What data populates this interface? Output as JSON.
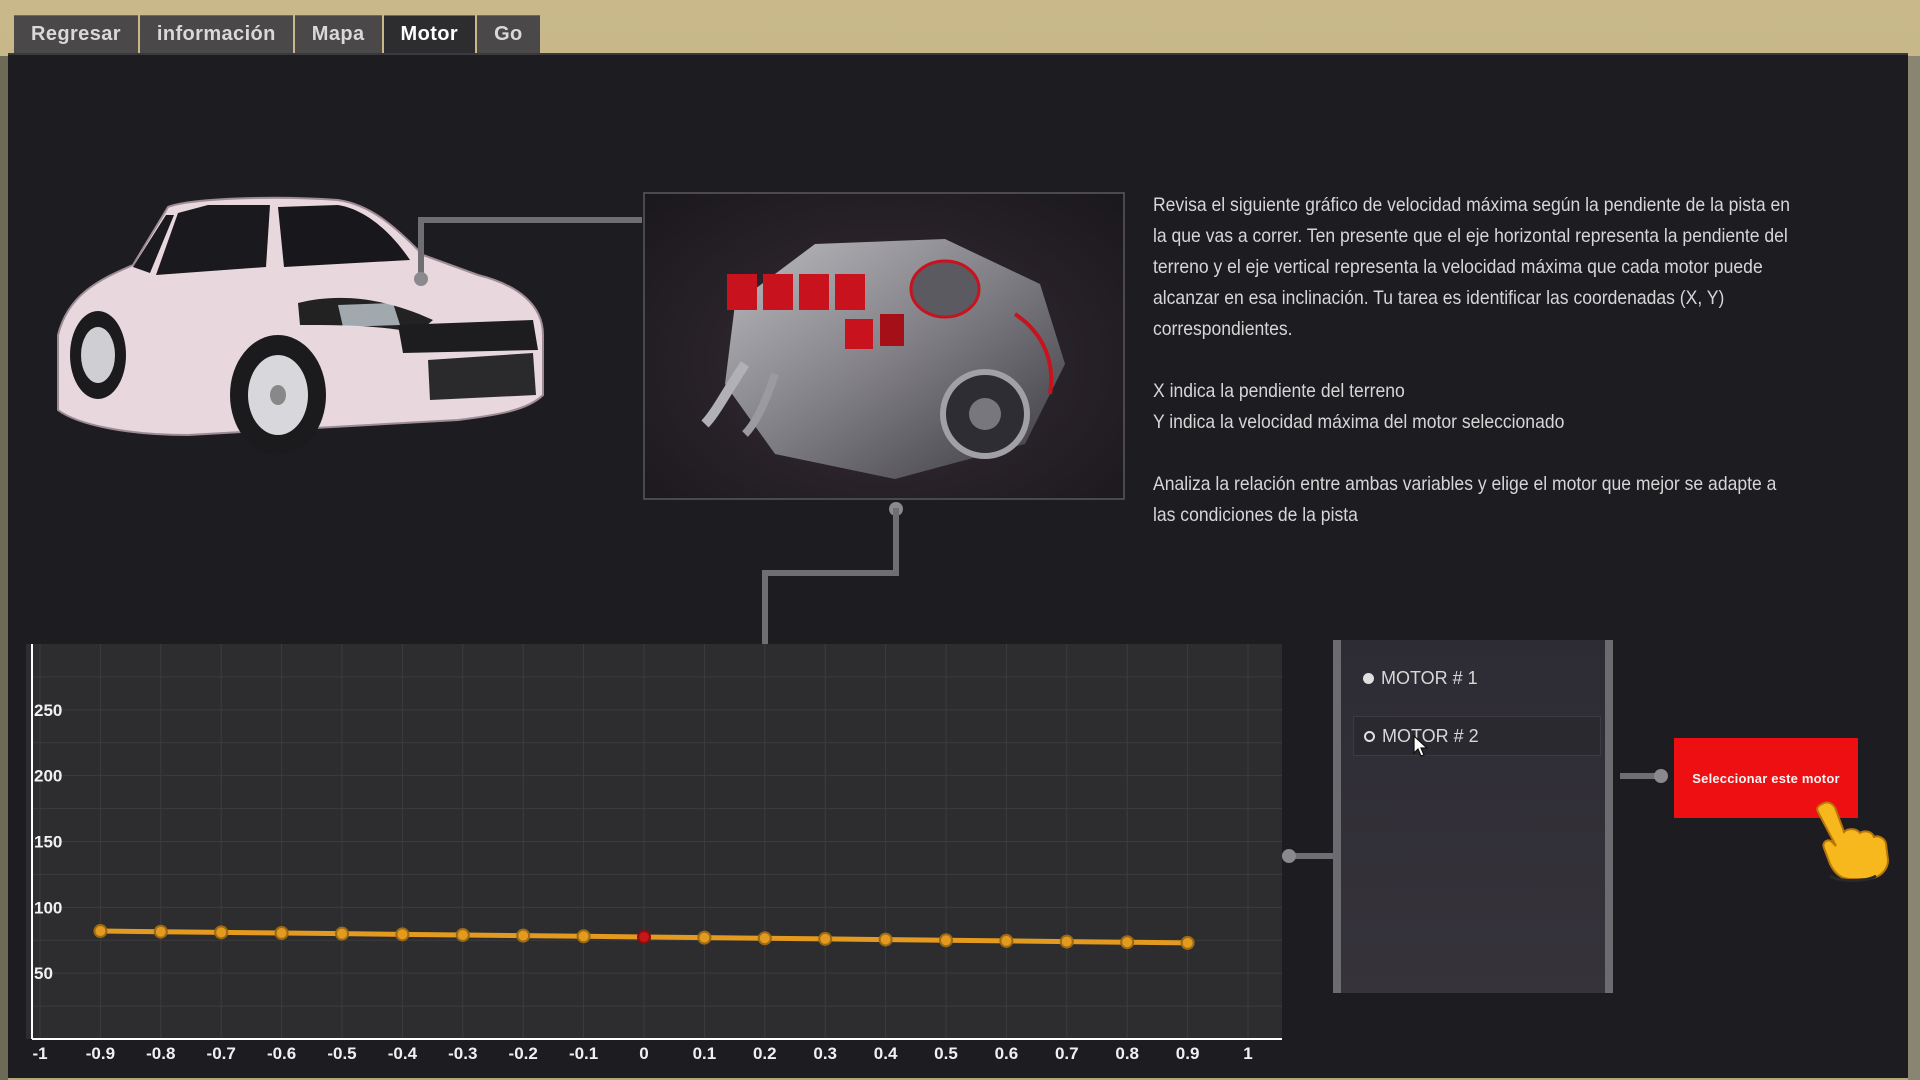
{
  "tabs": [
    {
      "label": "Regresar"
    },
    {
      "label": "información"
    },
    {
      "label": "Mapa"
    },
    {
      "label": "Motor"
    },
    {
      "label": "Go"
    }
  ],
  "active_tab": "Motor",
  "description": {
    "p1": "Revisa el siguiente gráfico de velocidad máxima según la pendiente de la pista en la que vas a correr. Ten presente que el eje horizontal representa la pendiente del terreno y el eje vertical representa la velocidad máxima que cada motor puede alcanzar en esa inclinación. Tu tarea es identificar las coordenadas (X, Y) correspondientes.",
    "p2a": "X indica la pendiente del terreno",
    "p2b": "Y indica la velocidad máxima del motor seleccionado",
    "p3": "Analiza la relación entre ambas variables y elige el motor que mejor se adapte a las condiciones de la pista"
  },
  "motors": {
    "items": [
      {
        "label": "MOTOR # 1",
        "selected": true
      },
      {
        "label": "MOTOR # 2",
        "selected": false
      }
    ]
  },
  "select_button": {
    "label": "Seleccionar este motor"
  },
  "colors": {
    "line": "#e39a1e",
    "highlight_point": "#c41717",
    "button": "#ee0f12",
    "panel": "#1d1c21"
  },
  "icons": {
    "car": "car-image",
    "engine": "engine-image",
    "hand": "pointing-hand-icon",
    "cursor": "mouse-cursor-icon"
  },
  "chart_data": {
    "type": "line",
    "x": [
      -0.9,
      -0.8,
      -0.7,
      -0.6,
      -0.5,
      -0.4,
      -0.3,
      -0.2,
      -0.1,
      0,
      0.1,
      0.2,
      0.3,
      0.4,
      0.5,
      0.6,
      0.7,
      0.8,
      0.9
    ],
    "series": [
      {
        "values": [
          82,
          81.5,
          81,
          80.5,
          80,
          79.5,
          79,
          78.5,
          78,
          77.5,
          77,
          76.5,
          76,
          75.5,
          75,
          74.5,
          74,
          73.5,
          73
        ]
      }
    ],
    "highlight_x": 0,
    "xticks": [
      "-1",
      "-0.9",
      "-0.8",
      "-0.7",
      "-0.6",
      "-0.5",
      "-0.4",
      "-0.3",
      "-0.2",
      "-0.1",
      "0",
      "0.1",
      "0.2",
      "0.3",
      "0.4",
      "0.5",
      "0.6",
      "0.7",
      "0.8",
      "0.9",
      "1"
    ],
    "yticks": [
      "50",
      "100",
      "150",
      "200",
      "250"
    ],
    "xlim": [
      -1,
      1
    ],
    "ylim": [
      0,
      300
    ],
    "grid": true,
    "xlabel": "",
    "ylabel": ""
  }
}
